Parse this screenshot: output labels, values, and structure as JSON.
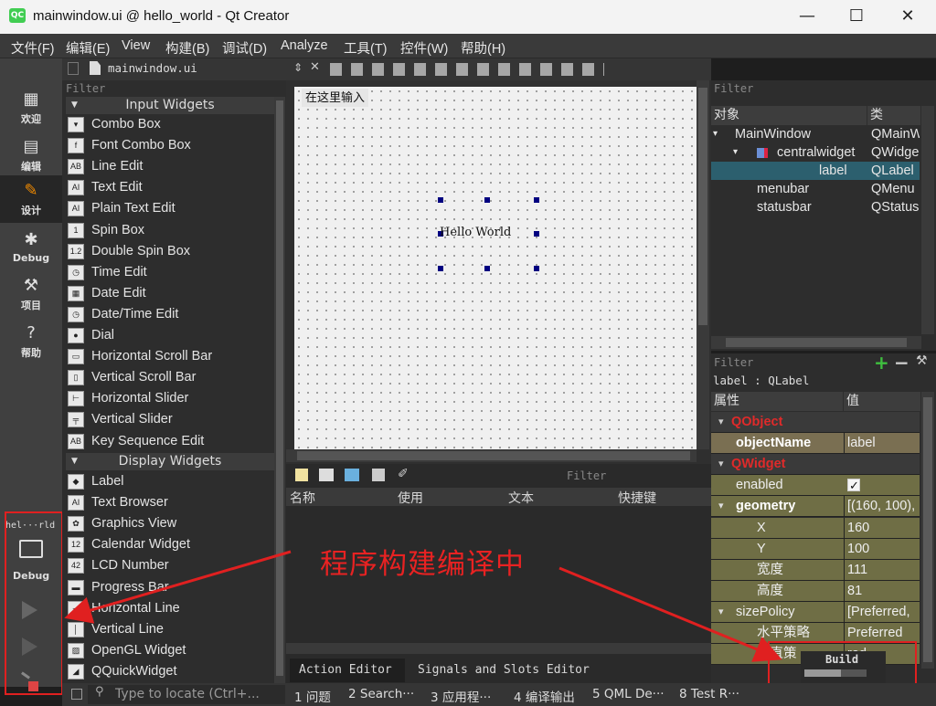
{
  "window": {
    "title": "mainwindow.ui @ hello_world - Qt Creator",
    "logo": "QC",
    "min": "—",
    "max": "☐",
    "close": "✕"
  },
  "menu": [
    "文件(F)",
    "编辑(E)",
    "View",
    "构建(B)",
    "调试(D)",
    "Analyze",
    "工具(T)",
    "控件(W)",
    "帮助(H)"
  ],
  "doc": {
    "file": "mainwindow.ui"
  },
  "modes": [
    {
      "label": "欢迎",
      "icon": "grid-icon"
    },
    {
      "label": "编辑",
      "icon": "edit-doc-icon"
    },
    {
      "label": "设计",
      "icon": "pencil-icon"
    },
    {
      "label": "Debug",
      "icon": "bug-icon"
    },
    {
      "label": "项目",
      "icon": "wrench-icon"
    },
    {
      "label": "帮助",
      "icon": "help-icon"
    }
  ],
  "kit": {
    "project": "hel···rld",
    "config": "Debug"
  },
  "widgetbox": {
    "filter": "Filter",
    "cat_input": "Input Widgets",
    "cat_display": "Display Widgets",
    "input_items": [
      {
        "label": "Combo Box",
        "ic": "▾"
      },
      {
        "label": "Font Combo Box",
        "ic": "f"
      },
      {
        "label": "Line Edit",
        "ic": "AB"
      },
      {
        "label": "Text Edit",
        "ic": "AI"
      },
      {
        "label": "Plain Text Edit",
        "ic": "AI"
      },
      {
        "label": "Spin Box",
        "ic": "1"
      },
      {
        "label": "Double Spin Box",
        "ic": "1.2"
      },
      {
        "label": "Time Edit",
        "ic": "◷"
      },
      {
        "label": "Date Edit",
        "ic": "▦"
      },
      {
        "label": "Date/Time Edit",
        "ic": "◷"
      },
      {
        "label": "Dial",
        "ic": "●"
      },
      {
        "label": "Horizontal Scroll Bar",
        "ic": "▭"
      },
      {
        "label": "Vertical Scroll Bar",
        "ic": "▯"
      },
      {
        "label": "Horizontal Slider",
        "ic": "⊢"
      },
      {
        "label": "Vertical Slider",
        "ic": "╤"
      },
      {
        "label": "Key Sequence Edit",
        "ic": "AB"
      }
    ],
    "display_items": [
      {
        "label": "Label",
        "ic": "◆"
      },
      {
        "label": "Text Browser",
        "ic": "AI"
      },
      {
        "label": "Graphics View",
        "ic": "✿"
      },
      {
        "label": "Calendar Widget",
        "ic": "12"
      },
      {
        "label": "LCD Number",
        "ic": "42"
      },
      {
        "label": "Progress Bar",
        "ic": "▬"
      },
      {
        "label": "Horizontal Line",
        "ic": "─"
      },
      {
        "label": "Vertical Line",
        "ic": "│"
      },
      {
        "label": "OpenGL Widget",
        "ic": "▨"
      },
      {
        "label": "QQuickWidget",
        "ic": "◢"
      }
    ]
  },
  "form": {
    "menu_placeholder": "在这里输入",
    "label_text": "Hello World"
  },
  "action_editor": {
    "filter": "Filter",
    "cols": [
      "名称",
      "使用",
      "文本",
      "快捷键"
    ],
    "tabs": [
      "Action Editor",
      "Signals and Slots Editor"
    ]
  },
  "object_inspector": {
    "filter": "Filter",
    "col_obj": "对象",
    "col_cls": "类",
    "rows": [
      {
        "name": "MainWindow",
        "cls": "QMainW",
        "indent": 1,
        "arrow": "▾"
      },
      {
        "name": "centralwidget",
        "cls": "QWidge",
        "indent": 2,
        "arrow": "▾"
      },
      {
        "name": "label",
        "cls": "QLabel",
        "indent": 3,
        "arrow": "",
        "selected": true
      },
      {
        "name": "menubar",
        "cls": "QMenu",
        "indent": 2,
        "arrow": ""
      },
      {
        "name": "statusbar",
        "cls": "QStatus",
        "indent": 2,
        "arrow": ""
      }
    ]
  },
  "property_editor": {
    "filter": "Filter",
    "object": "label : QLabel",
    "col_prop": "属性",
    "col_val": "值",
    "rows": [
      {
        "name": "QObject",
        "value": "",
        "kind": "section"
      },
      {
        "name": "objectName",
        "value": "label",
        "kind": "bold"
      },
      {
        "name": "QWidget",
        "value": "",
        "kind": "section"
      },
      {
        "name": "enabled",
        "value": "✓",
        "kind": "normal"
      },
      {
        "name": "geometry",
        "value": "[(160, 100),",
        "kind": "boldarrow"
      },
      {
        "name": "X",
        "value": "160",
        "kind": "sub"
      },
      {
        "name": "Y",
        "value": "100",
        "kind": "sub"
      },
      {
        "name": "宽度",
        "value": "111",
        "kind": "sub"
      },
      {
        "name": "高度",
        "value": "81",
        "kind": "sub"
      },
      {
        "name": "sizePolicy",
        "value": "[Preferred,",
        "kind": "arrow"
      },
      {
        "name": "水平策略",
        "value": "Preferred",
        "kind": "sub"
      },
      {
        "name": "垂直策",
        "value": "red",
        "kind": "sub"
      }
    ]
  },
  "build": {
    "label": "Build"
  },
  "bottombar": {
    "locate": "Type to locate (Ctrl+...",
    "panes": [
      "1 问题",
      "2 Search···",
      "3 应用程···",
      "4 编译输出",
      "5 QML De···",
      "8 Test R···"
    ]
  },
  "annotation": {
    "text": "程序构建编译中",
    "color": "#e82222"
  },
  "colors": {
    "selection": "#2c5f6e",
    "prop_bg": "#6f6e45",
    "prop_section": "#e02a2a"
  }
}
